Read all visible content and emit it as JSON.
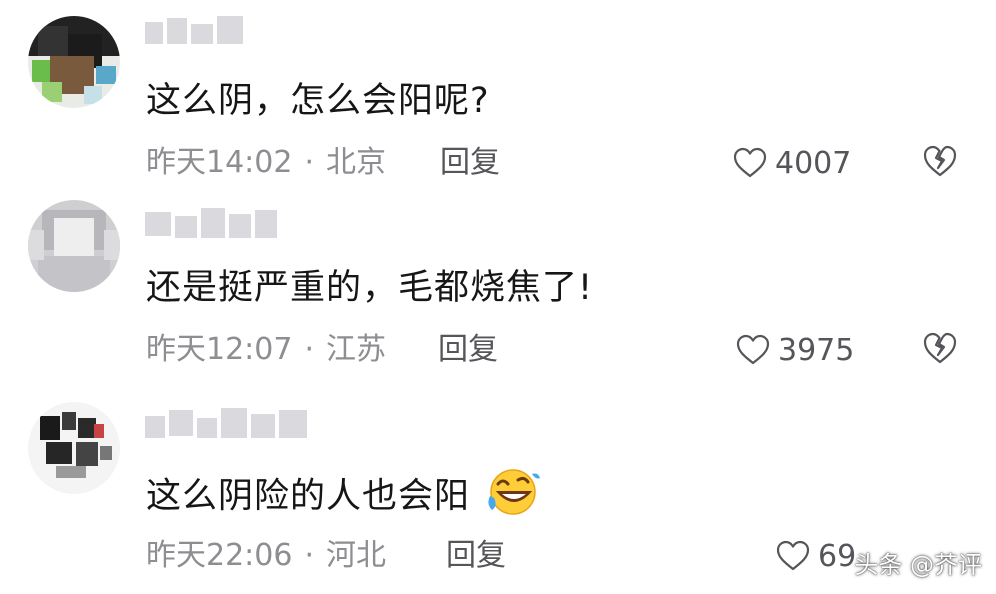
{
  "comments": [
    {
      "text": "这么阴，怎么会阳呢?",
      "time": "昨天14:02",
      "separator": "·",
      "location": "北京",
      "reply_label": "回复",
      "likes": "4007",
      "emoji": ""
    },
    {
      "text": "还是挺严重的，毛都烧焦了!",
      "time": "昨天12:07",
      "separator": "·",
      "location": "江苏",
      "reply_label": "回复",
      "likes": "3975",
      "emoji": ""
    },
    {
      "text": "这么阴险的人也会阳",
      "time": "昨天22:06",
      "separator": "·",
      "location": "河北",
      "reply_label": "回复",
      "likes": "69",
      "emoji": "rofl-emoji"
    }
  ],
  "watermark": "头条 @芥评",
  "icons": {
    "like": "heart-outline-icon",
    "dislike": "broken-heart-icon"
  },
  "colors": {
    "text": "#161616",
    "meta": "#8d8d92",
    "action": "#55555a"
  }
}
